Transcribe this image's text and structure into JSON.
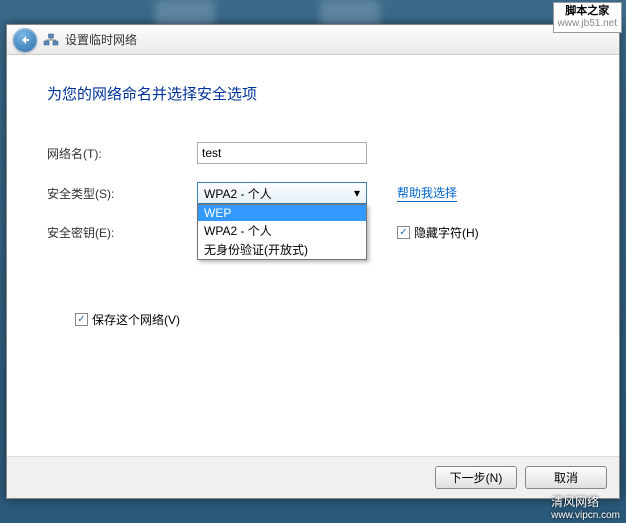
{
  "watermarks": {
    "tr_line1": "脚本之家",
    "tr_line2": "www.jb51.net",
    "br_line1": "清风网络",
    "br_line2": "www.vipcn.com"
  },
  "titlebar": {
    "title": "设置临时网络"
  },
  "heading": "为您的网络命名并选择安全选项",
  "form": {
    "network_name_label": "网络名(T):",
    "network_name_value": "test",
    "security_type_label": "安全类型(S):",
    "security_type_selected": "WPA2 - 个人",
    "security_options": [
      "WEP",
      "WPA2 - 个人",
      "无身份验证(开放式)"
    ],
    "security_highlighted_index": 0,
    "help_link": "帮助我选择",
    "security_key_label": "安全密钥(E):",
    "hide_chars_label": "隐藏字符(H)",
    "hide_chars_checked": "✓",
    "save_network_label": "保存这个网络(V)",
    "save_network_checked": "✓"
  },
  "footer": {
    "next_label": "下一步(N)",
    "cancel_label": "取消"
  }
}
